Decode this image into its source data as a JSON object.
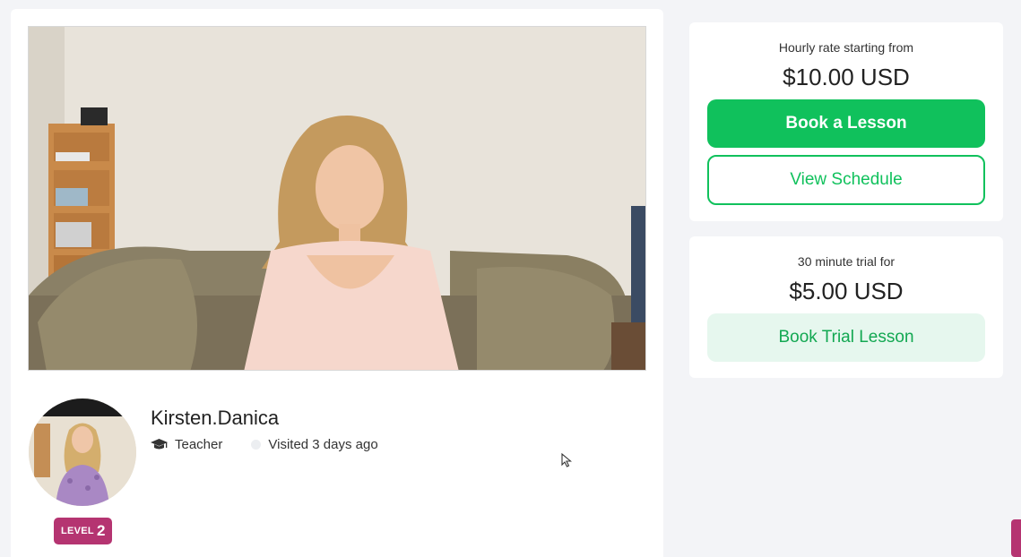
{
  "teacher": {
    "name": "Kirsten.Danica",
    "role": "Teacher",
    "visited": "Visited 3 days ago",
    "level_label": "LEVEL",
    "level_number": "2"
  },
  "rate_card": {
    "caption": "Hourly rate starting from",
    "price": "$10.00 USD",
    "book_label": "Book a Lesson",
    "schedule_label": "View Schedule"
  },
  "trial_card": {
    "caption": "30 minute trial for",
    "price": "$5.00 USD",
    "book_label": "Book Trial Lesson"
  },
  "colors": {
    "accent_green": "#10c15c",
    "level_magenta": "#b53471",
    "soft_green": "#e6f7ee"
  },
  "icons": [
    "graduation-cap-icon",
    "status-dot-icon",
    "cursor-icon"
  ]
}
